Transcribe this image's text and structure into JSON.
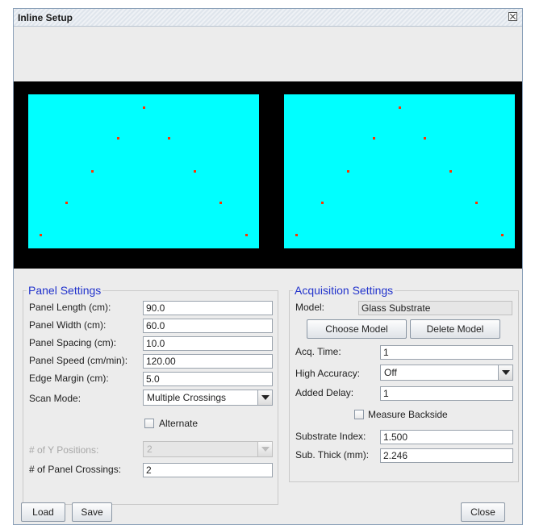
{
  "window": {
    "title": "Inline Setup"
  },
  "panel_settings": {
    "title": "Panel Settings",
    "panel_length": {
      "label": "Panel Length (cm):",
      "value": "90.0"
    },
    "panel_width": {
      "label": "Panel Width (cm):",
      "value": "60.0"
    },
    "panel_spacing": {
      "label": "Panel Spacing (cm):",
      "value": "10.0"
    },
    "panel_speed": {
      "label": "Panel Speed (cm/min):",
      "value": "120.00"
    },
    "edge_margin": {
      "label": "Edge Margin (cm):",
      "value": "5.0"
    },
    "scan_mode": {
      "label": "Scan Mode:",
      "value": "Multiple Crossings"
    },
    "alternate": {
      "label": "Alternate",
      "checked": false
    },
    "y_positions": {
      "label": "# of Y Positions:",
      "value": "2",
      "enabled": false
    },
    "panel_crossings": {
      "label": "# of Panel Crossings:",
      "value": "2"
    }
  },
  "acquisition_settings": {
    "title": "Acquisition Settings",
    "model": {
      "label": "Model:",
      "value": "Glass Substrate"
    },
    "choose_model": "Choose Model",
    "delete_model": "Delete Model",
    "acq_time": {
      "label": "Acq. Time:",
      "value": "1"
    },
    "high_accuracy": {
      "label": "High Accuracy:",
      "value": "Off"
    },
    "added_delay": {
      "label": "Added Delay:",
      "value": "1"
    },
    "measure_backside": {
      "label": "Measure Backside",
      "checked": false
    },
    "substrate_index": {
      "label": "Substrate Index:",
      "value": "1.500"
    },
    "sub_thick": {
      "label": "Sub. Thick (mm):",
      "value": "2.246"
    }
  },
  "buttons": {
    "load": "Load",
    "save": "Save",
    "close": "Close"
  },
  "colors": {
    "panel_fill": "#00ffff",
    "measurement_point": "#ff3300",
    "preview_background": "#000000",
    "group_title": "#2233cc"
  }
}
